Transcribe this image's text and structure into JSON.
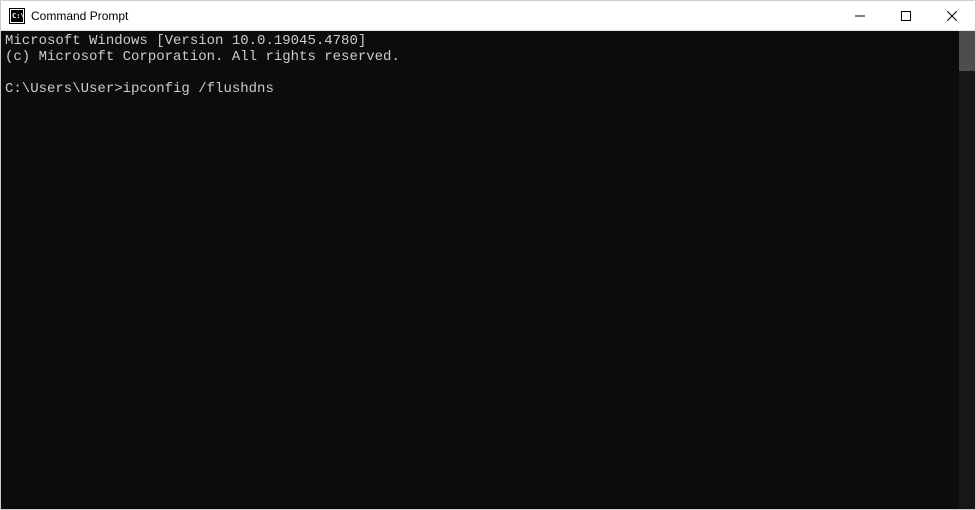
{
  "window": {
    "title": "Command Prompt"
  },
  "terminal": {
    "line1": "Microsoft Windows [Version 10.0.19045.4780]",
    "line2": "(c) Microsoft Corporation. All rights reserved.",
    "blank": "",
    "prompt": "C:\\Users\\User>",
    "command": "ipconfig /flushdns"
  }
}
